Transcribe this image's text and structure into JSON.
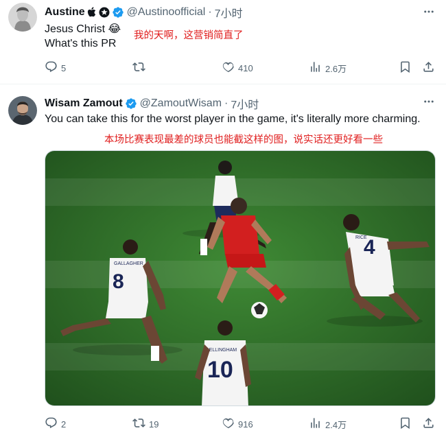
{
  "tweets": [
    {
      "display_name": "Austine",
      "handle": "@Austinoofficial",
      "time": "7小时",
      "text_lines": [
        "Jesus Christ 😂",
        "What's this PR"
      ],
      "annotation": "我的天啊，这营销简直了",
      "reply_count": "5",
      "retweet_count": "",
      "like_count": "410",
      "view_count": "2.6万"
    },
    {
      "display_name": "Wisam Zamout",
      "handle": "@ZamoutWisam",
      "time": "7小时",
      "text": "You can take this for the worst player in the game, it's literally more charming.",
      "annotation": "本场比赛表现最差的球员也能截这样的图，说实话还更好看一些",
      "jersey_numbers": [
        "8",
        "4",
        "10"
      ],
      "jersey_names": [
        "GALLAGHER",
        "RICE",
        "BELLINGHAM"
      ],
      "reply_count": "2",
      "retweet_count": "19",
      "like_count": "916",
      "view_count": "2.4万"
    }
  ],
  "separator": "·",
  "colors": {
    "accent": "#1d9bf0",
    "muted": "#536471",
    "annotation": "#e01e1e",
    "pitch": "#2f6b2a"
  },
  "icons": [
    "reply-icon",
    "retweet-icon",
    "like-icon",
    "views-icon",
    "bookmark-icon",
    "share-icon",
    "more-icon",
    "verified-icon"
  ]
}
